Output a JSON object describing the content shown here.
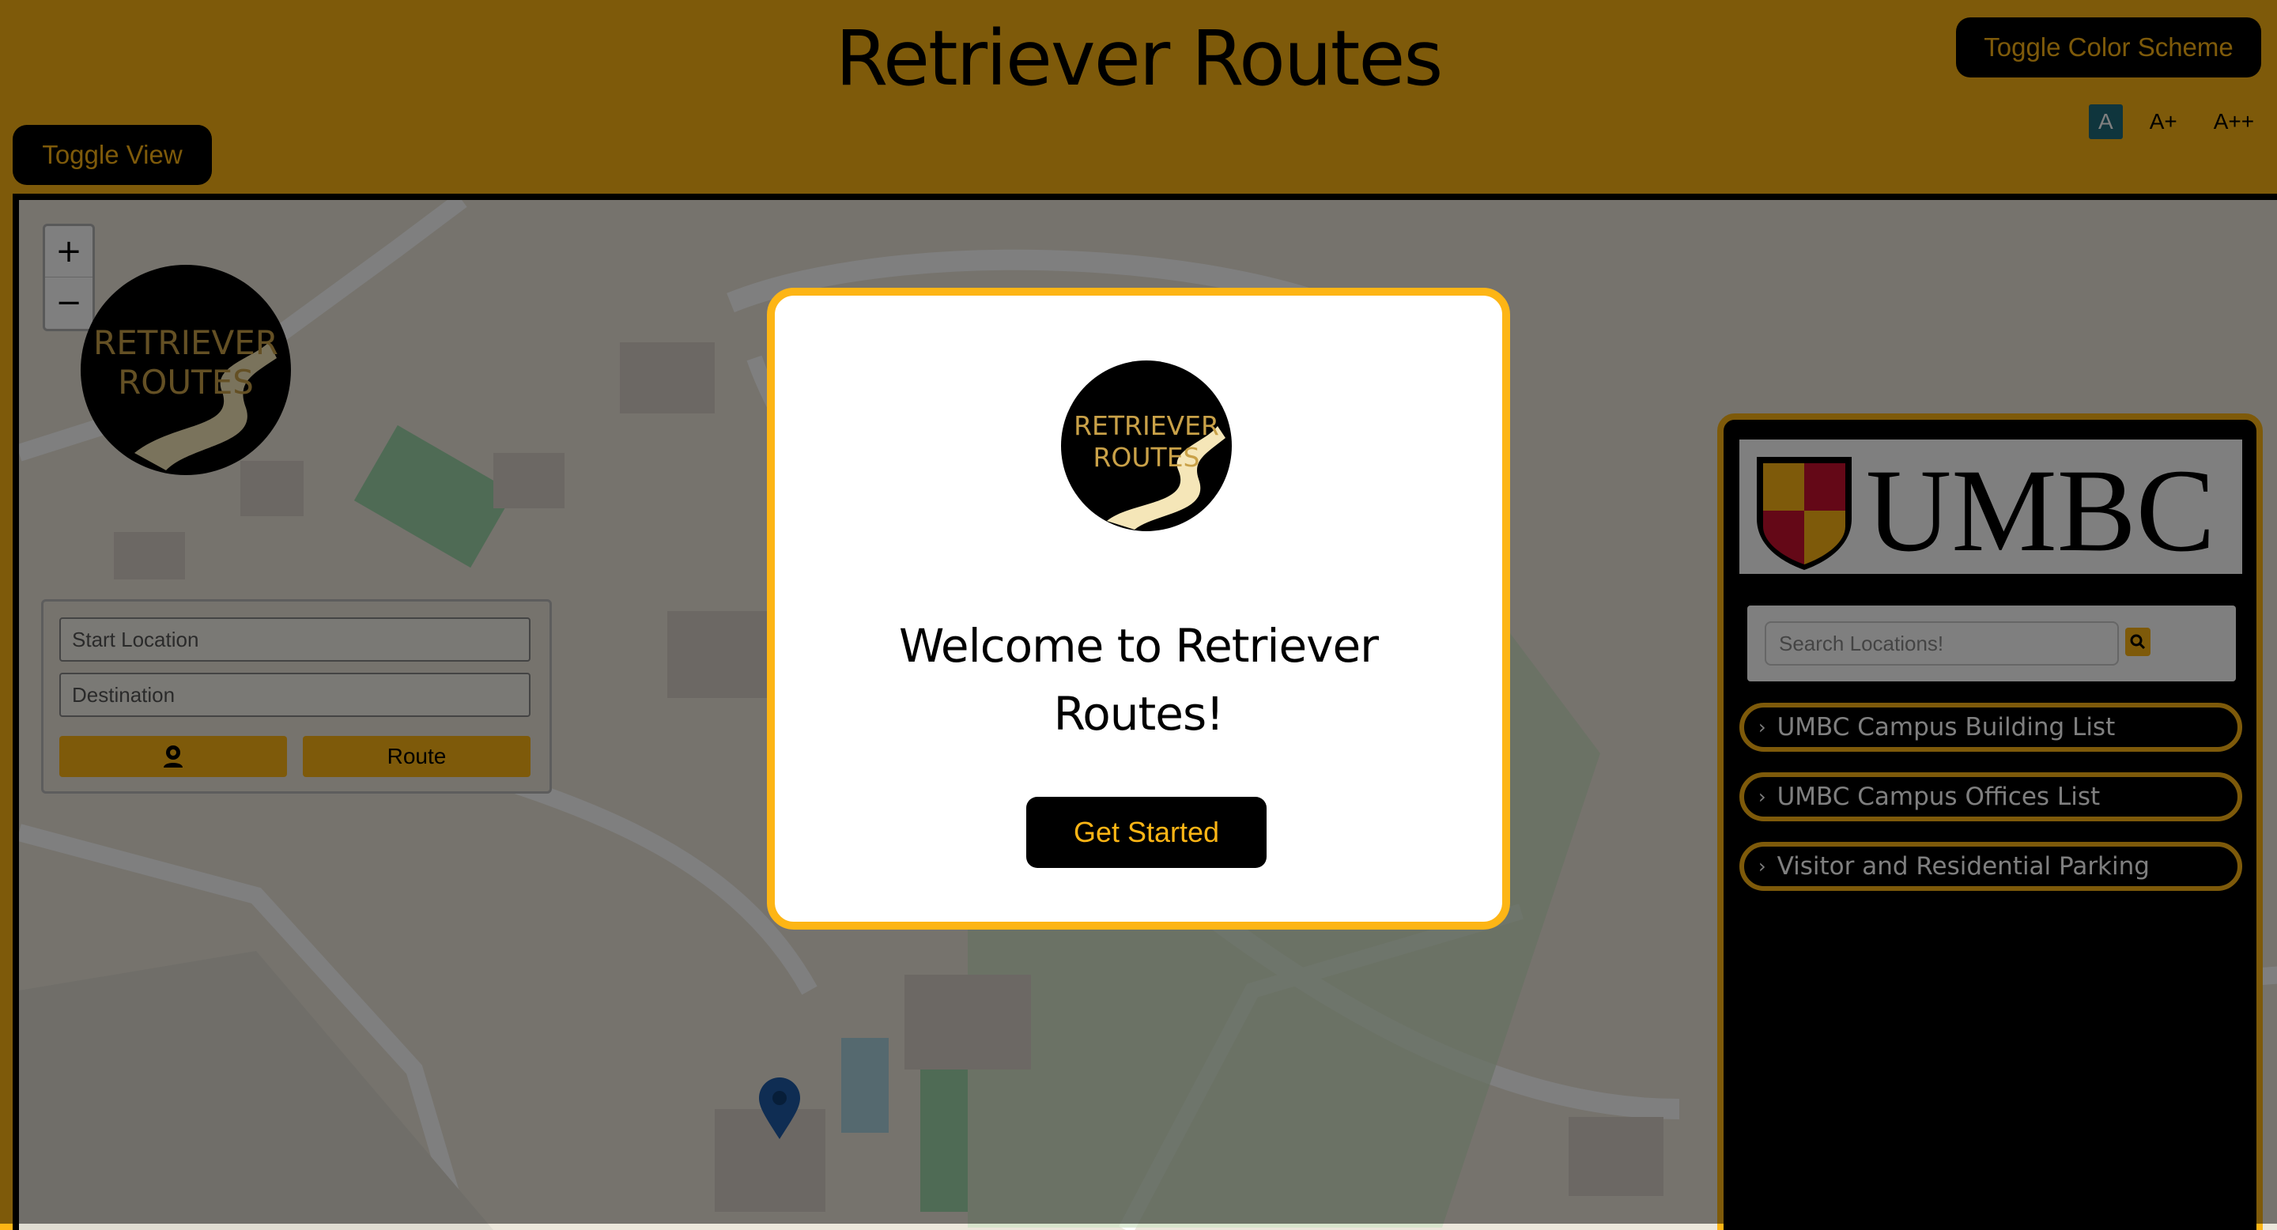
{
  "header": {
    "title": "Retriever Routes",
    "toggle_scheme_label": "Toggle Color Scheme",
    "toggle_view_label": "Toggle View",
    "font_sizes": [
      "A",
      "A+",
      "A++"
    ],
    "font_size_active": "A"
  },
  "map": {
    "zoom_in": "+",
    "zoom_out": "−",
    "logo_text_top": "RETRIEVER",
    "logo_text_bottom": "ROUTES"
  },
  "route_panel": {
    "start_placeholder": "Start Location",
    "destination_placeholder": "Destination",
    "route_label": "Route"
  },
  "sidebar": {
    "brand": "UMBC",
    "search_placeholder": "Search Locations!",
    "sections": [
      {
        "label": "UMBC Campus Building List"
      },
      {
        "label": "UMBC Campus Offices List"
      },
      {
        "label": "Visitor and Residential Parking"
      }
    ]
  },
  "modal": {
    "title_line1": "Welcome to Retriever",
    "title_line2": "Routes!",
    "cta_label": "Get Started"
  },
  "colors": {
    "brand_gold": "#fdb515",
    "brand_black": "#000000",
    "active_font_bg": "#1f6a7a"
  }
}
